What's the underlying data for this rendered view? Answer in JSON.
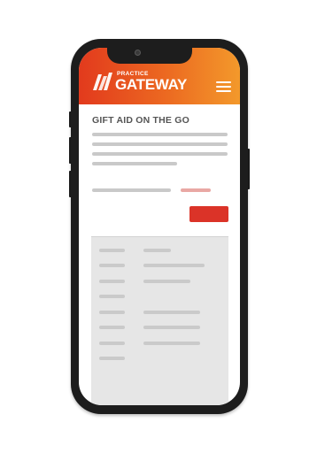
{
  "brand": {
    "small": "PRACTICE",
    "big": "GATEWAY",
    "gradient": [
      "#e23a1d",
      "#ec6a21",
      "#f3992b"
    ]
  },
  "page": {
    "title": "GIFT AID ON THE GO"
  },
  "colors": {
    "phone_frame": "#1d1d1d",
    "accent_red": "#db3328",
    "placeholder_gray": "#c9c9c9",
    "panel_bg": "#e6e6e6"
  },
  "icons": {
    "logo": "practice-gateway-logo-mark",
    "menu": "hamburger-menu-icon"
  }
}
